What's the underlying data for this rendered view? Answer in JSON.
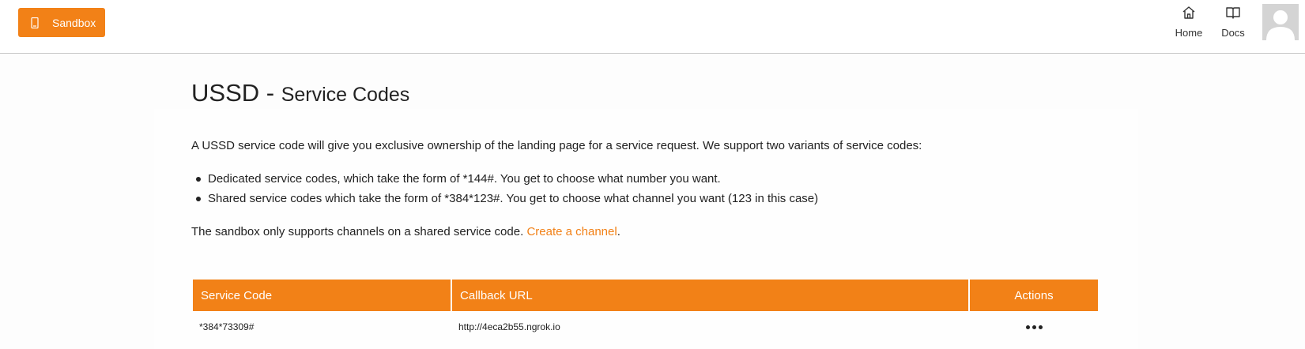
{
  "header": {
    "sandbox_button": {
      "label": "Sandbox",
      "icon": "phone-icon"
    },
    "nav": [
      {
        "label": "Home",
        "icon": "home-icon"
      },
      {
        "label": "Docs",
        "icon": "book-icon"
      }
    ],
    "avatar": "user-avatar"
  },
  "page": {
    "title": "USSD - ",
    "subtitle": "Service Codes",
    "description": "A USSD service code will give you exclusive ownership of the landing page for a service request. We support two variants of service codes:",
    "bullets": [
      "Dedicated service codes, which take the form of *144#. You get to choose what number you want.",
      "Shared service codes which take the form of *384*123#. You get to choose what channel you want (123 in this case)"
    ],
    "note_text": "The sandbox only supports channels on a shared service code. ",
    "note_link": "Create a channel",
    "note_end": "."
  },
  "table": {
    "headers": [
      "Service Code",
      "Callback URL",
      "Actions"
    ],
    "rows": [
      {
        "service_code": "*384*73309#",
        "callback_url": "http://4eca2b55.ngrok.io",
        "actions_icon": "more-horizontal-icon"
      }
    ]
  },
  "colors": {
    "accent": "#f28117"
  }
}
